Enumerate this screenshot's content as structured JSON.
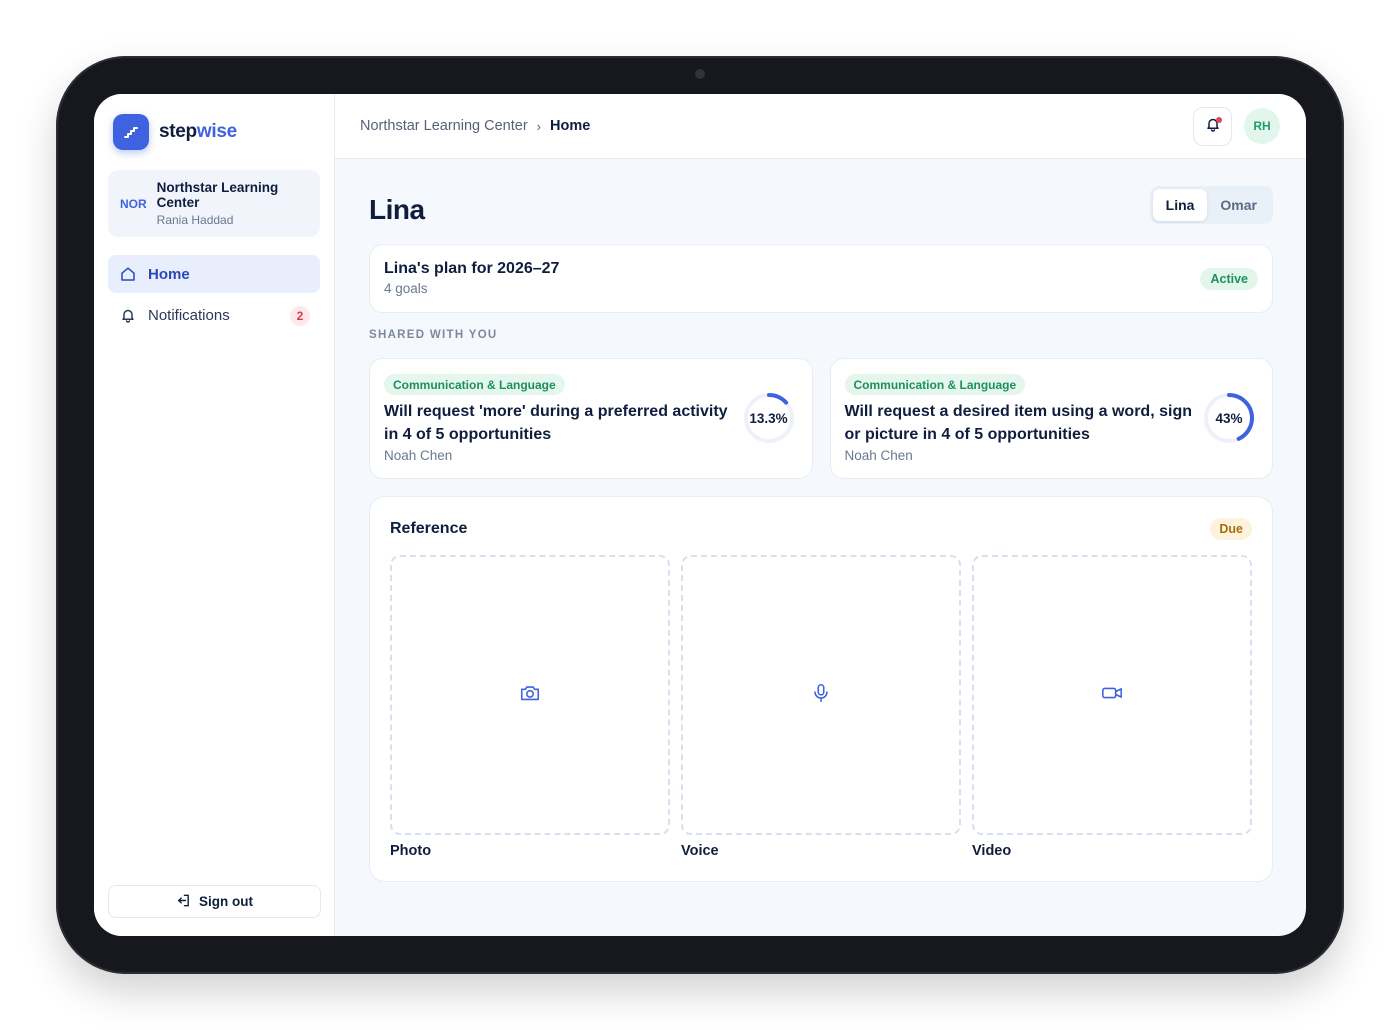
{
  "brand": {
    "name_part1": "step",
    "name_part2": "wise",
    "accent": "#3f63e0",
    "logo_icon": "stairs-icon"
  },
  "org": {
    "abbr": "NOR",
    "name": "Northstar Learning Center",
    "user": "Rania Haddad"
  },
  "nav": {
    "home": {
      "label": "Home",
      "icon": "home-icon"
    },
    "notifications": {
      "label": "Notifications",
      "icon": "bell-icon",
      "count": "2"
    }
  },
  "signout": {
    "label": "Sign out",
    "icon": "sign-out-icon"
  },
  "topbar": {
    "crumb_root": "Northstar Learning Center",
    "crumb_sep": "›",
    "crumb_current": "Home",
    "avatar": "RH"
  },
  "page": {
    "title": "Lina"
  },
  "children": {
    "tabs": [
      "Lina",
      "Omar"
    ],
    "selected": "Lina"
  },
  "plan": {
    "title": "Lina's plan for 2026–27",
    "subtitle": "4 goals",
    "status": "Active"
  },
  "shared": {
    "label": "SHARED WITH YOU",
    "goals": [
      {
        "tag": "Communication & Language",
        "text": "Will request 'more' during a preferred activity in 4 of 5 opportunities",
        "owner": "Noah Chen",
        "progress_label": "13.3%",
        "progress": 13.3
      },
      {
        "tag": "Communication & Language",
        "text": "Will request a desired item using a word, sign or picture in 4 of 5 opportunities",
        "owner": "Noah Chen",
        "progress_label": "43%",
        "progress": 43
      }
    ]
  },
  "reference": {
    "title": "Reference",
    "status": "Due",
    "slots": [
      {
        "label": "Photo",
        "icon": "camera-icon"
      },
      {
        "label": "Voice",
        "icon": "microphone-icon"
      },
      {
        "label": "Video",
        "icon": "video-camera-icon"
      }
    ]
  }
}
